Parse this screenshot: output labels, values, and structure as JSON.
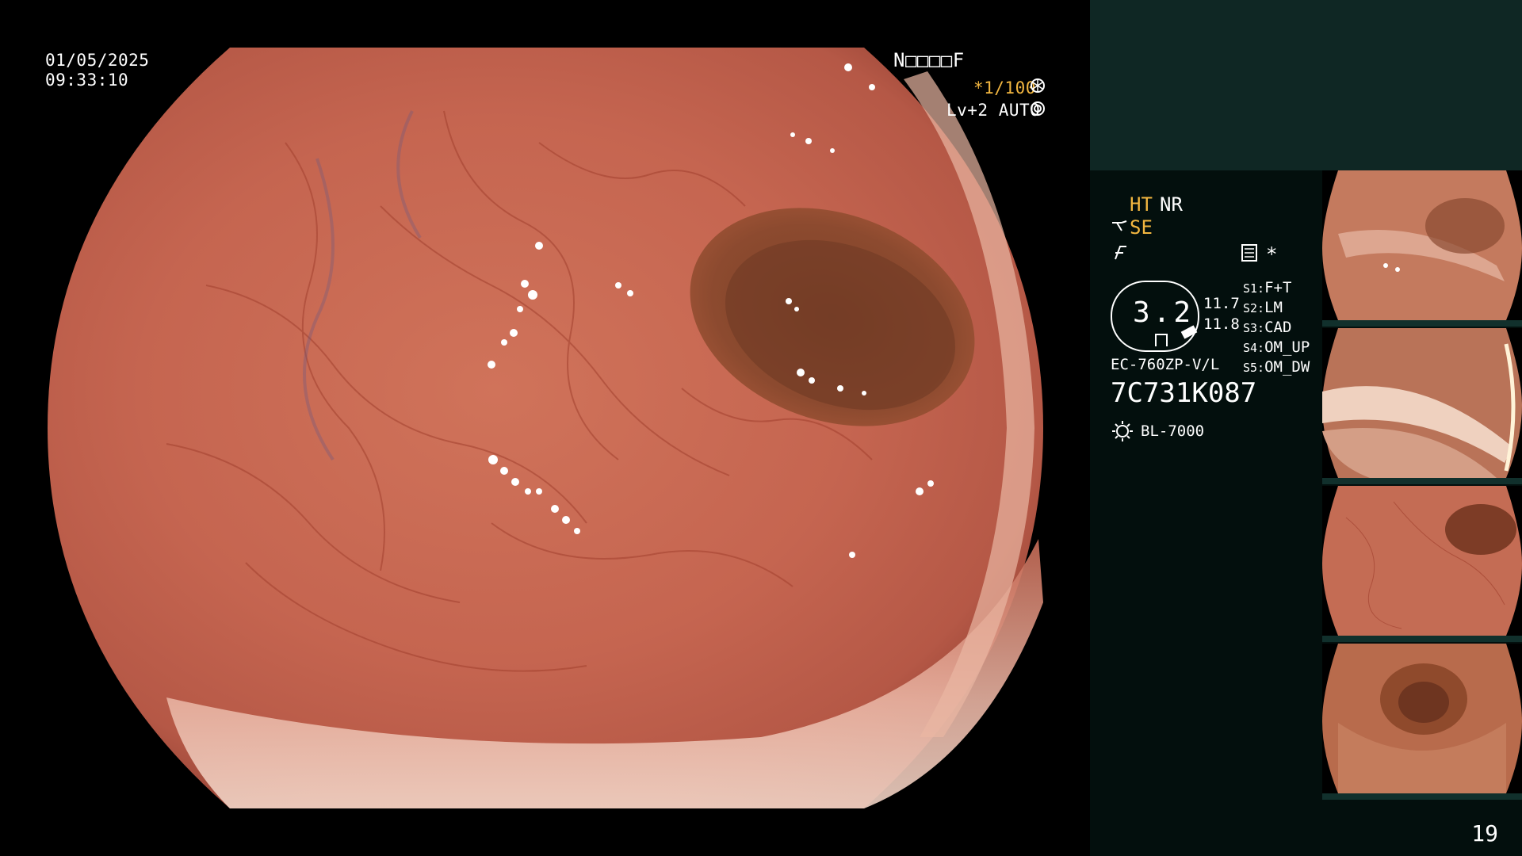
{
  "overlay": {
    "date": "01/05/2025",
    "time": "09:33:10",
    "id_code": "N□□□□F",
    "shutter": "*1/100",
    "shutter_icon": "aperture-icon",
    "level": "Lv+2 AUTO",
    "level_icon": "target-icon"
  },
  "settings": {
    "ht": "HT",
    "nr": "NR",
    "se": "SE",
    "se_icon": "scope-icon",
    "f_icon": "flash-icon",
    "memo_icon": "memo-icon",
    "asterisk": "*",
    "scope_value": "3.2",
    "range_upper": "11.7",
    "range_lower": "11.8",
    "modes": [
      {
        "key": "S1:",
        "value": "F+T"
      },
      {
        "key": "S2:",
        "value": "LM"
      },
      {
        "key": "S3:",
        "value": "CAD"
      },
      {
        "key": "S4:",
        "value": "OM_UP"
      },
      {
        "key": "S5:",
        "value": "OM_DW"
      }
    ],
    "scope_model": "EC-760ZP-V/L",
    "serial": "7C731K087",
    "light_icon": "light-source-icon",
    "light_source": "BL-7000"
  },
  "colors": {
    "accent_yellow": "#f2b640",
    "panel_top": "#0f2724",
    "panel_bg": "#030f0d",
    "tissue": "#c86852"
  },
  "page_number": "19"
}
